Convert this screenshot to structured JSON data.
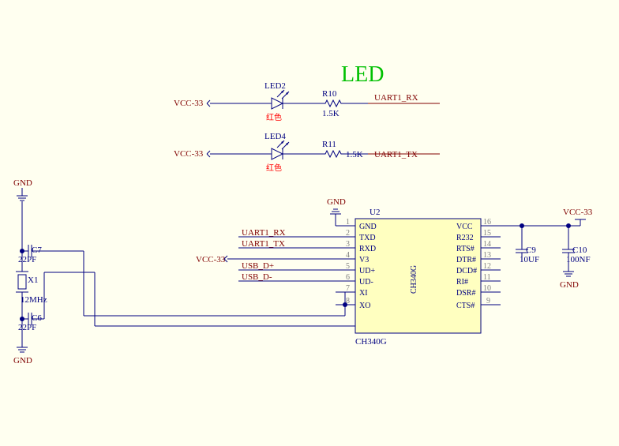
{
  "title": "LED",
  "power": {
    "gnd": "GND",
    "vcc33": "VCC-33"
  },
  "nets": {
    "uart1_rx": "UART1_RX",
    "uart1_tx": "UART1_TX",
    "usb_dp": "USB_D+",
    "usb_dm": "USB_D-"
  },
  "c7": {
    "d": "C7",
    "v": "22PF"
  },
  "c6": {
    "d": "C6",
    "v": "22PF"
  },
  "x1": {
    "d": "X1",
    "v": "12MHz"
  },
  "led2": {
    "d": "LED2",
    "v": "红色"
  },
  "led4": {
    "d": "LED4",
    "v": "红色"
  },
  "r10": {
    "d": "R10",
    "v": "1.5K"
  },
  "r11": {
    "d": "R11",
    "v": "1.5K"
  },
  "c9": {
    "d": "C9",
    "v": "10UF"
  },
  "c10": {
    "d": "C10",
    "v": "100NF"
  },
  "u2": {
    "d": "U2",
    "v": "CH340G",
    "part": "CH340G",
    "pins": {
      "1": {
        "num": "1",
        "name": "GND"
      },
      "2": {
        "num": "2",
        "name": "TXD"
      },
      "3": {
        "num": "3",
        "name": "RXD"
      },
      "4": {
        "num": "4",
        "name": "V3"
      },
      "5": {
        "num": "5",
        "name": "UD+"
      },
      "6": {
        "num": "6",
        "name": "UD-"
      },
      "7": {
        "num": "7",
        "name": "XI"
      },
      "8": {
        "num": "8",
        "name": "XO"
      },
      "9": {
        "num": "9",
        "name": "CTS#"
      },
      "10": {
        "num": "10",
        "name": "DSR#"
      },
      "11": {
        "num": "11",
        "name": "RI#"
      },
      "12": {
        "num": "12",
        "name": "DCD#"
      },
      "13": {
        "num": "13",
        "name": "DTR#"
      },
      "14": {
        "num": "14",
        "name": "RTS#"
      },
      "15": {
        "num": "15",
        "name": "R232"
      },
      "16": {
        "num": "16",
        "name": "VCC"
      }
    }
  }
}
